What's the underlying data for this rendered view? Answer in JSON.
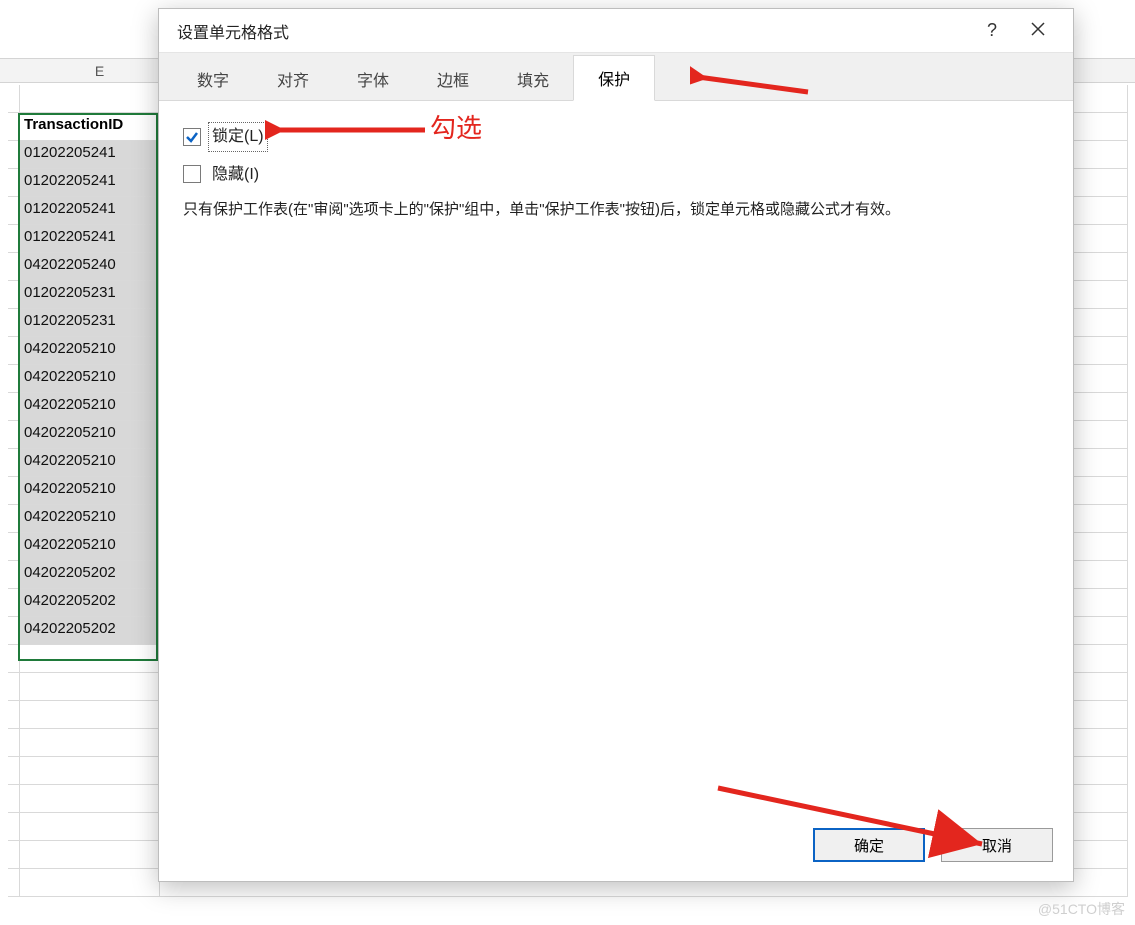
{
  "sheet": {
    "column_label": "E",
    "header": "TransactionID",
    "rows": [
      "01202205241",
      "01202205241",
      "01202205241",
      "01202205241",
      "04202205240",
      "01202205231",
      "01202205231",
      "04202205210",
      "04202205210",
      "04202205210",
      "04202205210",
      "04202205210",
      "04202205210",
      "04202205210",
      "04202205210",
      "04202205202",
      "04202205202",
      "04202205202"
    ]
  },
  "dialog": {
    "title": "设置单元格格式",
    "help_symbol": "?",
    "tabs": {
      "number": "数字",
      "alignment": "对齐",
      "font": "字体",
      "border": "边框",
      "fill": "填充",
      "protection": "保护"
    },
    "protection": {
      "locked_label": "锁定(L)",
      "locked_checked": true,
      "hidden_label": "隐藏(I)",
      "hidden_checked": false,
      "hint": "只有保护工作表(在\"审阅\"选项卡上的\"保护\"组中，单击\"保护工作表\"按钮)后，锁定单元格或隐藏公式才有效。"
    },
    "buttons": {
      "ok": "确定",
      "cancel": "取消"
    }
  },
  "annotations": {
    "check_label": "勾选"
  },
  "watermark": "@51CTO博客"
}
